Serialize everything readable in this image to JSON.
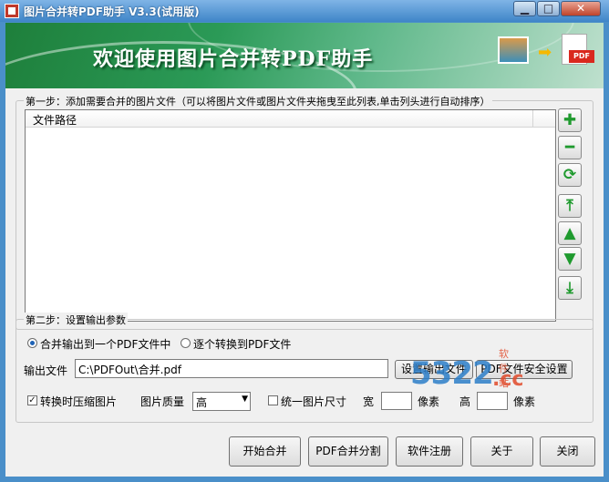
{
  "window": {
    "title": "图片合并转PDF助手 V3.3(试用版)",
    "min_glyph": "▁",
    "max_glyph": "□",
    "close_glyph": "✕"
  },
  "banner": {
    "text": "欢迎使用图片合并转PDF助手",
    "pdf_tag": "PDF"
  },
  "step1": {
    "title": "第一步：添加需要合并的图片文件（可以将图片文件或图片文件夹拖曳至此列表,单击列头进行自动排序）",
    "column_header": "文件路径",
    "side_buttons": [
      {
        "name": "add-button",
        "icon": "plus-icon",
        "glyph": "✚"
      },
      {
        "name": "remove-button",
        "icon": "minus-icon",
        "glyph": "━"
      },
      {
        "name": "clear-button",
        "icon": "refresh-icon",
        "glyph": "⟳"
      },
      {
        "name": "move-top-button",
        "icon": "arrow-top-icon",
        "glyph": "⤒"
      },
      {
        "name": "move-up-button",
        "icon": "arrow-up-icon",
        "glyph": "▲"
      },
      {
        "name": "move-down-button",
        "icon": "arrow-down-icon",
        "glyph": "▼"
      },
      {
        "name": "move-bottom-button",
        "icon": "arrow-bottom-icon",
        "glyph": "⤓"
      }
    ]
  },
  "step2": {
    "title": "第二步：设置输出参数",
    "radio_merge": "合并输出到一个PDF文件中",
    "radio_each": "逐个转换到PDF文件",
    "output_label": "输出文件",
    "output_value": "C:\\PDFOut\\合并.pdf",
    "set_output_button": "设置输出文件",
    "pdf_security_button": "PDF文件安全设置",
    "compress_label": "转换时压缩图片",
    "quality_label": "图片质量",
    "quality_value": "高",
    "uniform_size_label": "统一图片尺寸",
    "width_label": "宽",
    "width_unit": "像素",
    "height_label": "高",
    "height_unit": "像素"
  },
  "footer": {
    "start": "开始合并",
    "split": "PDF合并分割",
    "register": "软件注册",
    "about": "关于",
    "close": "关闭"
  },
  "watermark": {
    "num": "5322",
    "cc": ".cc",
    "site": "软件站"
  }
}
